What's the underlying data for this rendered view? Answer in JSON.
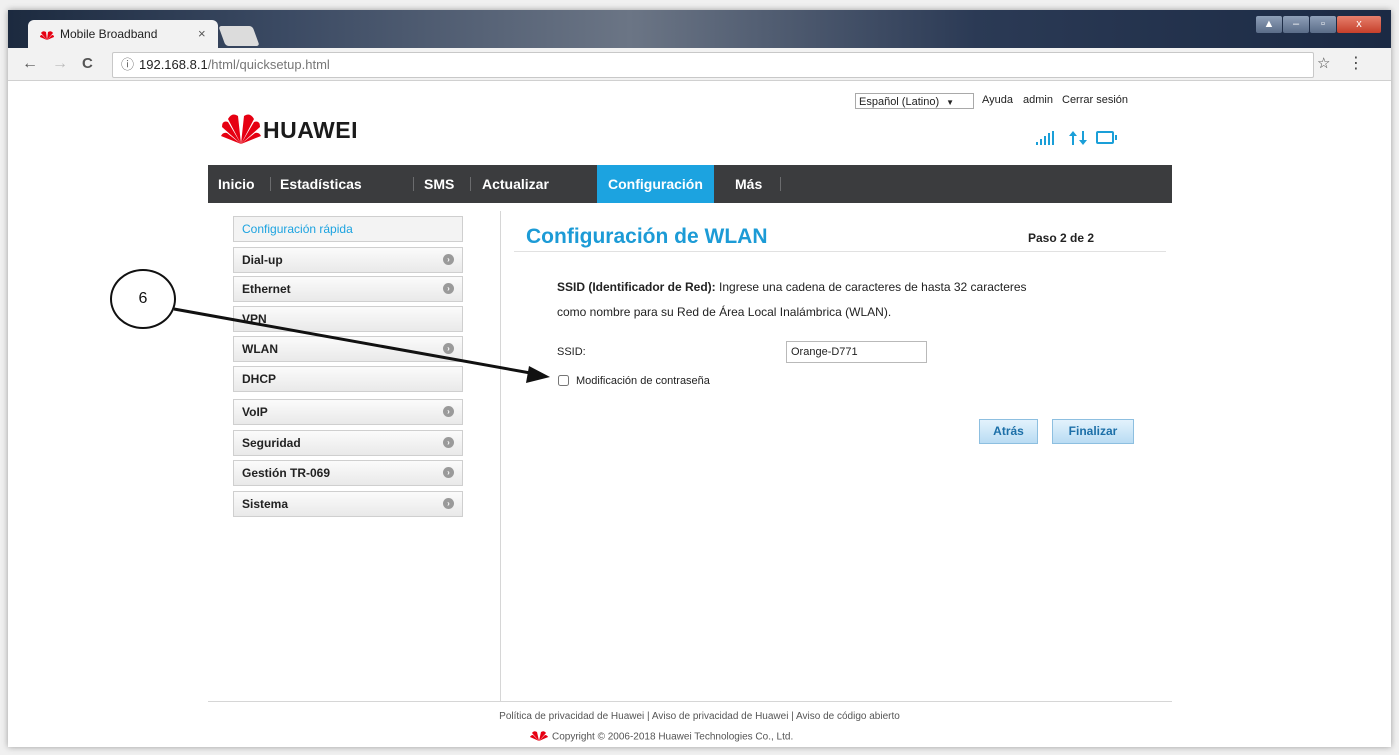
{
  "browser": {
    "tab_title": "Mobile Broadband",
    "tab_close": "×",
    "url_host": "192.168.8.1",
    "url_path": "/html/quicksetup.html",
    "window_buttons": [
      "▲",
      "–",
      "▫",
      "x"
    ],
    "nav_back": "←",
    "nav_forward": "→",
    "nav_reload": "C",
    "info_icon": "ⓘ",
    "star": "☆",
    "menu": "⋮"
  },
  "header": {
    "language": "Español (Latino)",
    "language_arrow": "▼",
    "help": "Ayuda",
    "user": "admin",
    "logout": "Cerrar sesión",
    "brand": "HUAWEI",
    "brand_color": "#e60012"
  },
  "status_icons": [
    "signal-icon",
    "data-transfer-icon",
    "screen-icon"
  ],
  "navbar": {
    "items": [
      "Inicio",
      "Estadísticas",
      "SMS",
      "Actualizar",
      "Configuración",
      "Más"
    ],
    "active": "Configuración",
    "active_color": "#1ca3e0"
  },
  "sidebar": {
    "items": [
      {
        "label": "Configuración rápida",
        "arrow": ""
      },
      {
        "label": "Dial-up",
        "arrow": "›"
      },
      {
        "label": "Ethernet",
        "arrow": "›"
      },
      {
        "label": "VPN",
        "arrow": ""
      },
      {
        "label": "WLAN",
        "arrow": "›"
      },
      {
        "label": "DHCP",
        "arrow": ""
      },
      {
        "label": "VoIP",
        "arrow": "›"
      },
      {
        "label": "Seguridad",
        "arrow": "›"
      },
      {
        "label": "Gestión TR-069",
        "arrow": "›"
      },
      {
        "label": "Sistema",
        "arrow": "›"
      }
    ]
  },
  "content": {
    "title": "Configuración de WLAN",
    "step": "Paso 2 de 2",
    "desc_bold": "SSID (Identificador de Red):",
    "desc_rest": " Ingrese una cadena de caracteres de hasta 32 caracteres",
    "desc_line2": "como nombre para su Red de Área Local Inalámbrica (WLAN).",
    "ssid_label": "SSID:",
    "ssid_value": "Orange-D771",
    "password_checkbox_label": "Modificación de contraseña",
    "back_button": "Atrás",
    "finish_button": "Finalizar"
  },
  "footer": {
    "link1": "Política de privacidad de Huawei",
    "link2": "Aviso de privacidad de Huawei",
    "link3": "Aviso de código abierto",
    "separator": " | ",
    "copyright": "Copyright © 2006-2018 Huawei Technologies Co., Ltd."
  },
  "annotation": {
    "number": "6"
  }
}
